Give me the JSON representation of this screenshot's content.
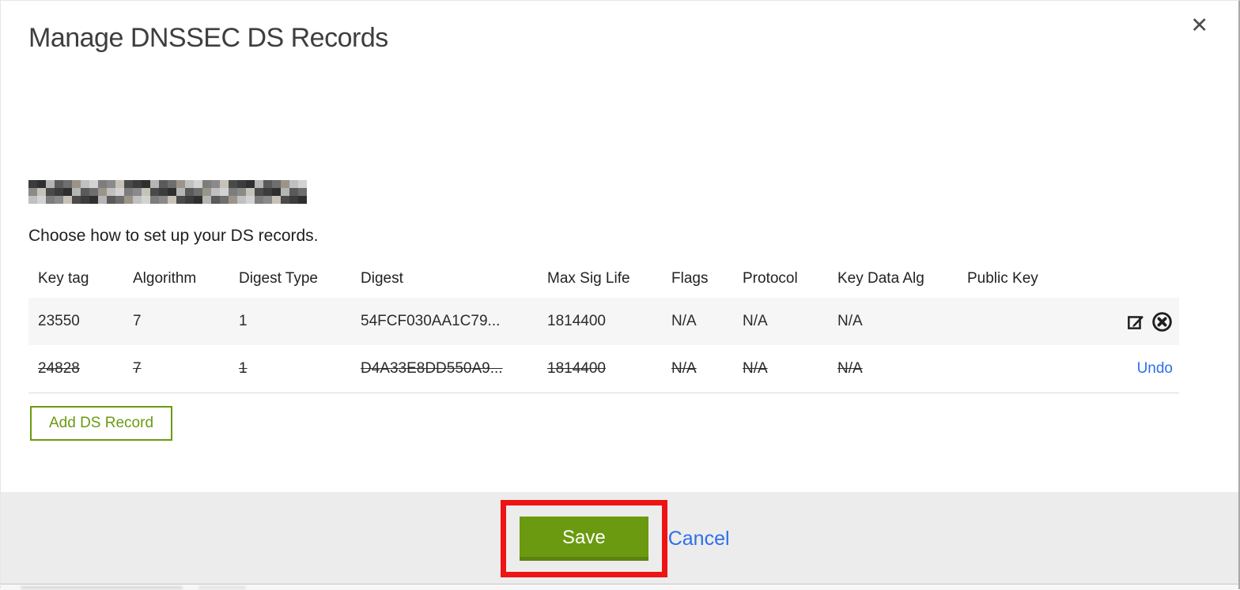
{
  "modal": {
    "title": "Manage DNSSEC DS Records",
    "close_label": "✕",
    "domain_redacted": true,
    "subtitle": "Choose how to set up your DS records.",
    "table": {
      "headers": [
        "Key tag",
        "Algorithm",
        "Digest Type",
        "Digest",
        "Max Sig Life",
        "Flags",
        "Protocol",
        "Key Data Alg",
        "Public Key",
        ""
      ],
      "rows": [
        {
          "key_tag": "23550",
          "algorithm": "7",
          "digest_type": "1",
          "digest": "54FCF030AA1C79...",
          "max_sig_life": "1814400",
          "flags": "N/A",
          "protocol": "N/A",
          "key_data_alg": "N/A",
          "public_key": "",
          "state": "normal",
          "actions": [
            "edit",
            "delete"
          ]
        },
        {
          "key_tag": "24828",
          "algorithm": "7",
          "digest_type": "1",
          "digest": "D4A33E8DD550A9...",
          "max_sig_life": "1814400",
          "flags": "N/A",
          "protocol": "N/A",
          "key_data_alg": "N/A",
          "public_key": "",
          "state": "deleted",
          "action_label": "Undo"
        }
      ]
    },
    "add_button_label": "Add DS Record",
    "footer": {
      "save_label": "Save",
      "cancel_label": "Cancel"
    }
  },
  "colors": {
    "green": "#6b9a10",
    "green-dark": "#5c830d",
    "link-blue": "#2e6fe8",
    "red": "#ee1414",
    "footer-bg": "#ececec",
    "row-alt-bg": "#f6f6f6",
    "title-text": "#3e3e3e"
  },
  "redaction_palette": [
    "#4a4a4a",
    "#6e6e6e",
    "#8a8a8a",
    "#b5b5b5",
    "#d2d2d2",
    "#3c3c3c",
    "#9b9488",
    "#c7c2b8",
    "#5a5a5a",
    "#7d7d7d",
    "#2f2f2f",
    "#c0c0c0"
  ]
}
